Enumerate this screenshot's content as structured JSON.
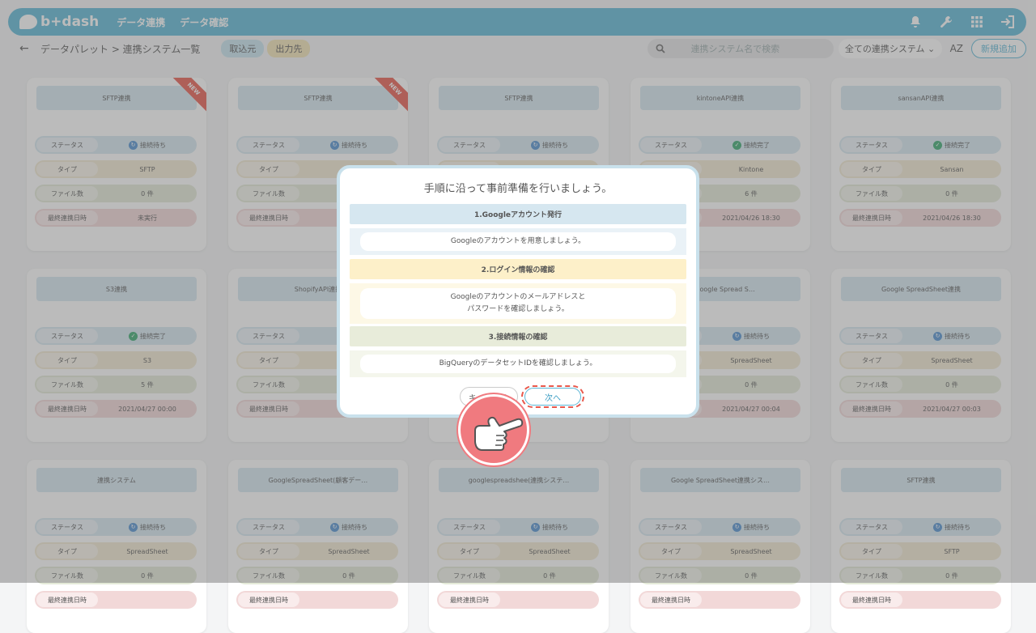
{
  "nav": {
    "brand": "b+dash",
    "links": [
      "データ連携",
      "データ確認"
    ],
    "icons": [
      "bell-icon",
      "wrench-icon",
      "grid-icon",
      "logout-icon"
    ]
  },
  "subbar": {
    "back_icon": "←",
    "breadcrumb": "データパレット > 連携システム一覧",
    "tab_in": "取込元",
    "tab_out": "出力先",
    "search_placeholder": "連携システム名で検索",
    "filter": "全ての連携システム ⌄",
    "sort": "AZ",
    "add": "新規追加"
  },
  "labels": {
    "status": "ステータス",
    "type": "タイプ",
    "files": "ファイル数",
    "last": "最終連携日時",
    "new": "NEW"
  },
  "cards": [
    {
      "title": "SFTP連携",
      "status": "接続待ち",
      "ok": false,
      "type": "SFTP",
      "files": "0 件",
      "last": "未実行",
      "new": true
    },
    {
      "title": "SFTP連携",
      "status": "接続待ち",
      "ok": false,
      "type": "",
      "files": "",
      "last": "",
      "new": true
    },
    {
      "title": "SFTP連携",
      "status": "接続待ち",
      "ok": false,
      "type": "",
      "files": "",
      "last": "",
      "new": false
    },
    {
      "title": "kintoneAPI連携",
      "status": "接続完了",
      "ok": true,
      "type": "Kintone",
      "files": "6 件",
      "last": "2021/04/26 18:30",
      "new": false
    },
    {
      "title": "sansanAPI連携",
      "status": "接続完了",
      "ok": true,
      "type": "Sansan",
      "files": "0 件",
      "last": "2021/04/26 18:30",
      "new": false
    },
    {
      "title": "S3連携",
      "status": "接続完了",
      "ok": true,
      "type": "S3",
      "files": "5 件",
      "last": "2021/04/27 00:00",
      "new": false
    },
    {
      "title": "ShopifyAPI連携",
      "status": "",
      "ok": true,
      "type": "",
      "files": "",
      "last": "",
      "new": false
    },
    {
      "title": "",
      "status": "",
      "ok": false,
      "type": "",
      "files": "",
      "last": "",
      "new": false
    },
    {
      "title": "ム(Google Spread S…",
      "status": "接続待ち",
      "ok": false,
      "type": "SpreadSheet",
      "files": "0 件",
      "last": "2021/04/27 00:04",
      "new": false
    },
    {
      "title": "Google SpreadSheet連携",
      "status": "接続待ち",
      "ok": false,
      "type": "SpreadSheet",
      "files": "0 件",
      "last": "2021/04/27 00:03",
      "new": false
    },
    {
      "title": "連携システム",
      "status": "接続待ち",
      "ok": false,
      "type": "SpreadSheet",
      "files": "0 件",
      "last": "",
      "new": false
    },
    {
      "title": "GoogleSpreadSheet(顧客デー…",
      "status": "接続待ち",
      "ok": false,
      "type": "SpreadSheet",
      "files": "0 件",
      "last": "",
      "new": false
    },
    {
      "title": "googlespreadshee(連携システ…",
      "status": "接続待ち",
      "ok": false,
      "type": "SpreadSheet",
      "files": "0 件",
      "last": "",
      "new": false
    },
    {
      "title": "Google SpreadSheet連携シス…",
      "status": "接続待ち",
      "ok": false,
      "type": "SpreadSheet",
      "files": "0 件",
      "last": "",
      "new": false
    },
    {
      "title": "SFTP連携",
      "status": "接続待ち",
      "ok": false,
      "type": "SFTP",
      "files": "0 件",
      "last": "",
      "new": false
    }
  ],
  "modal": {
    "title": "手順に沿って事前準備を行いましょう。",
    "step1_title": "1.Googleアカウント発行",
    "step1_body": "Googleのアカウントを用意しましょう。",
    "step2_title": "2.ログイン情報の確認",
    "step2_body_line1": "Googleのアカウントのメールアドレスと",
    "step2_body_line2": "パスワードを確認しましょう。",
    "step3_title": "3.接続情報の確認",
    "step3_body": "BigQueryのデータセットIDを確認しましょう。",
    "cancel": "キャンセル",
    "next": "次へ"
  }
}
